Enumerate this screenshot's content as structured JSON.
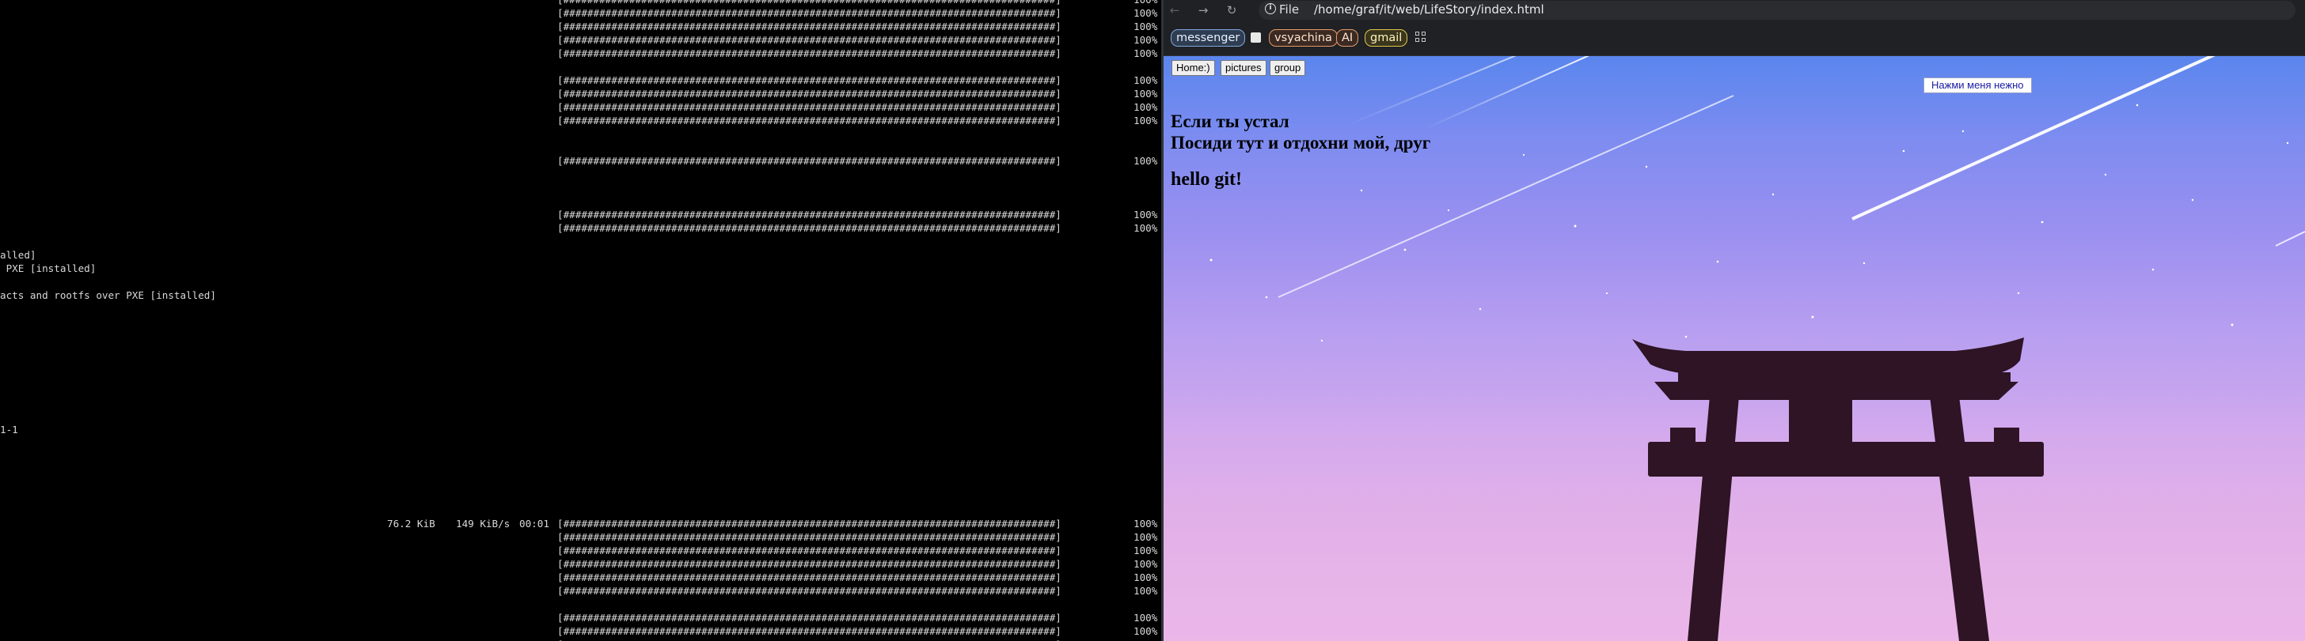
{
  "terminal": {
    "bar_text": "[##################################################################################]",
    "percent": "100%",
    "fragments": {
      "installed_1": "alled]",
      "installed_2": " PXE [installed]",
      "installed_3": "acts and rootfs over PXE [installed]",
      "version": "1-1",
      "size": "76.2 KiB",
      "speed": "149 KiB/s",
      "eta": "00:01"
    }
  },
  "browser": {
    "nav": {
      "back_icon": "←",
      "forward_icon": "→",
      "reload_icon": "↻"
    },
    "address": {
      "info_icon": "i",
      "scheme": "File",
      "url": "/home/graf/it/web/LifeStory/index.html"
    },
    "bookmarks": [
      {
        "label": "messenger",
        "color": "#7fa8e0"
      },
      {
        "label": "",
        "color": "#e8e8e8"
      },
      {
        "label": "vsyachina",
        "color": "#e89a6a"
      },
      {
        "label": "AI",
        "color": "#e89a6a"
      },
      {
        "label": "gmail",
        "color": "#e0c64a"
      }
    ],
    "apps_icon": "apps-grid-icon"
  },
  "page": {
    "nav_buttons": [
      "Home:)",
      "pictures",
      "group"
    ],
    "cta_button": "Нажми меня нежно",
    "heading_lines": [
      "Если ты устал",
      "Посиди тут и отдохни мой, друг"
    ],
    "hello": "hello git!",
    "colors": {
      "sky_top": "#5a86ee",
      "sky_bottom": "#e2b8ea",
      "torii": "#2e1424"
    }
  }
}
